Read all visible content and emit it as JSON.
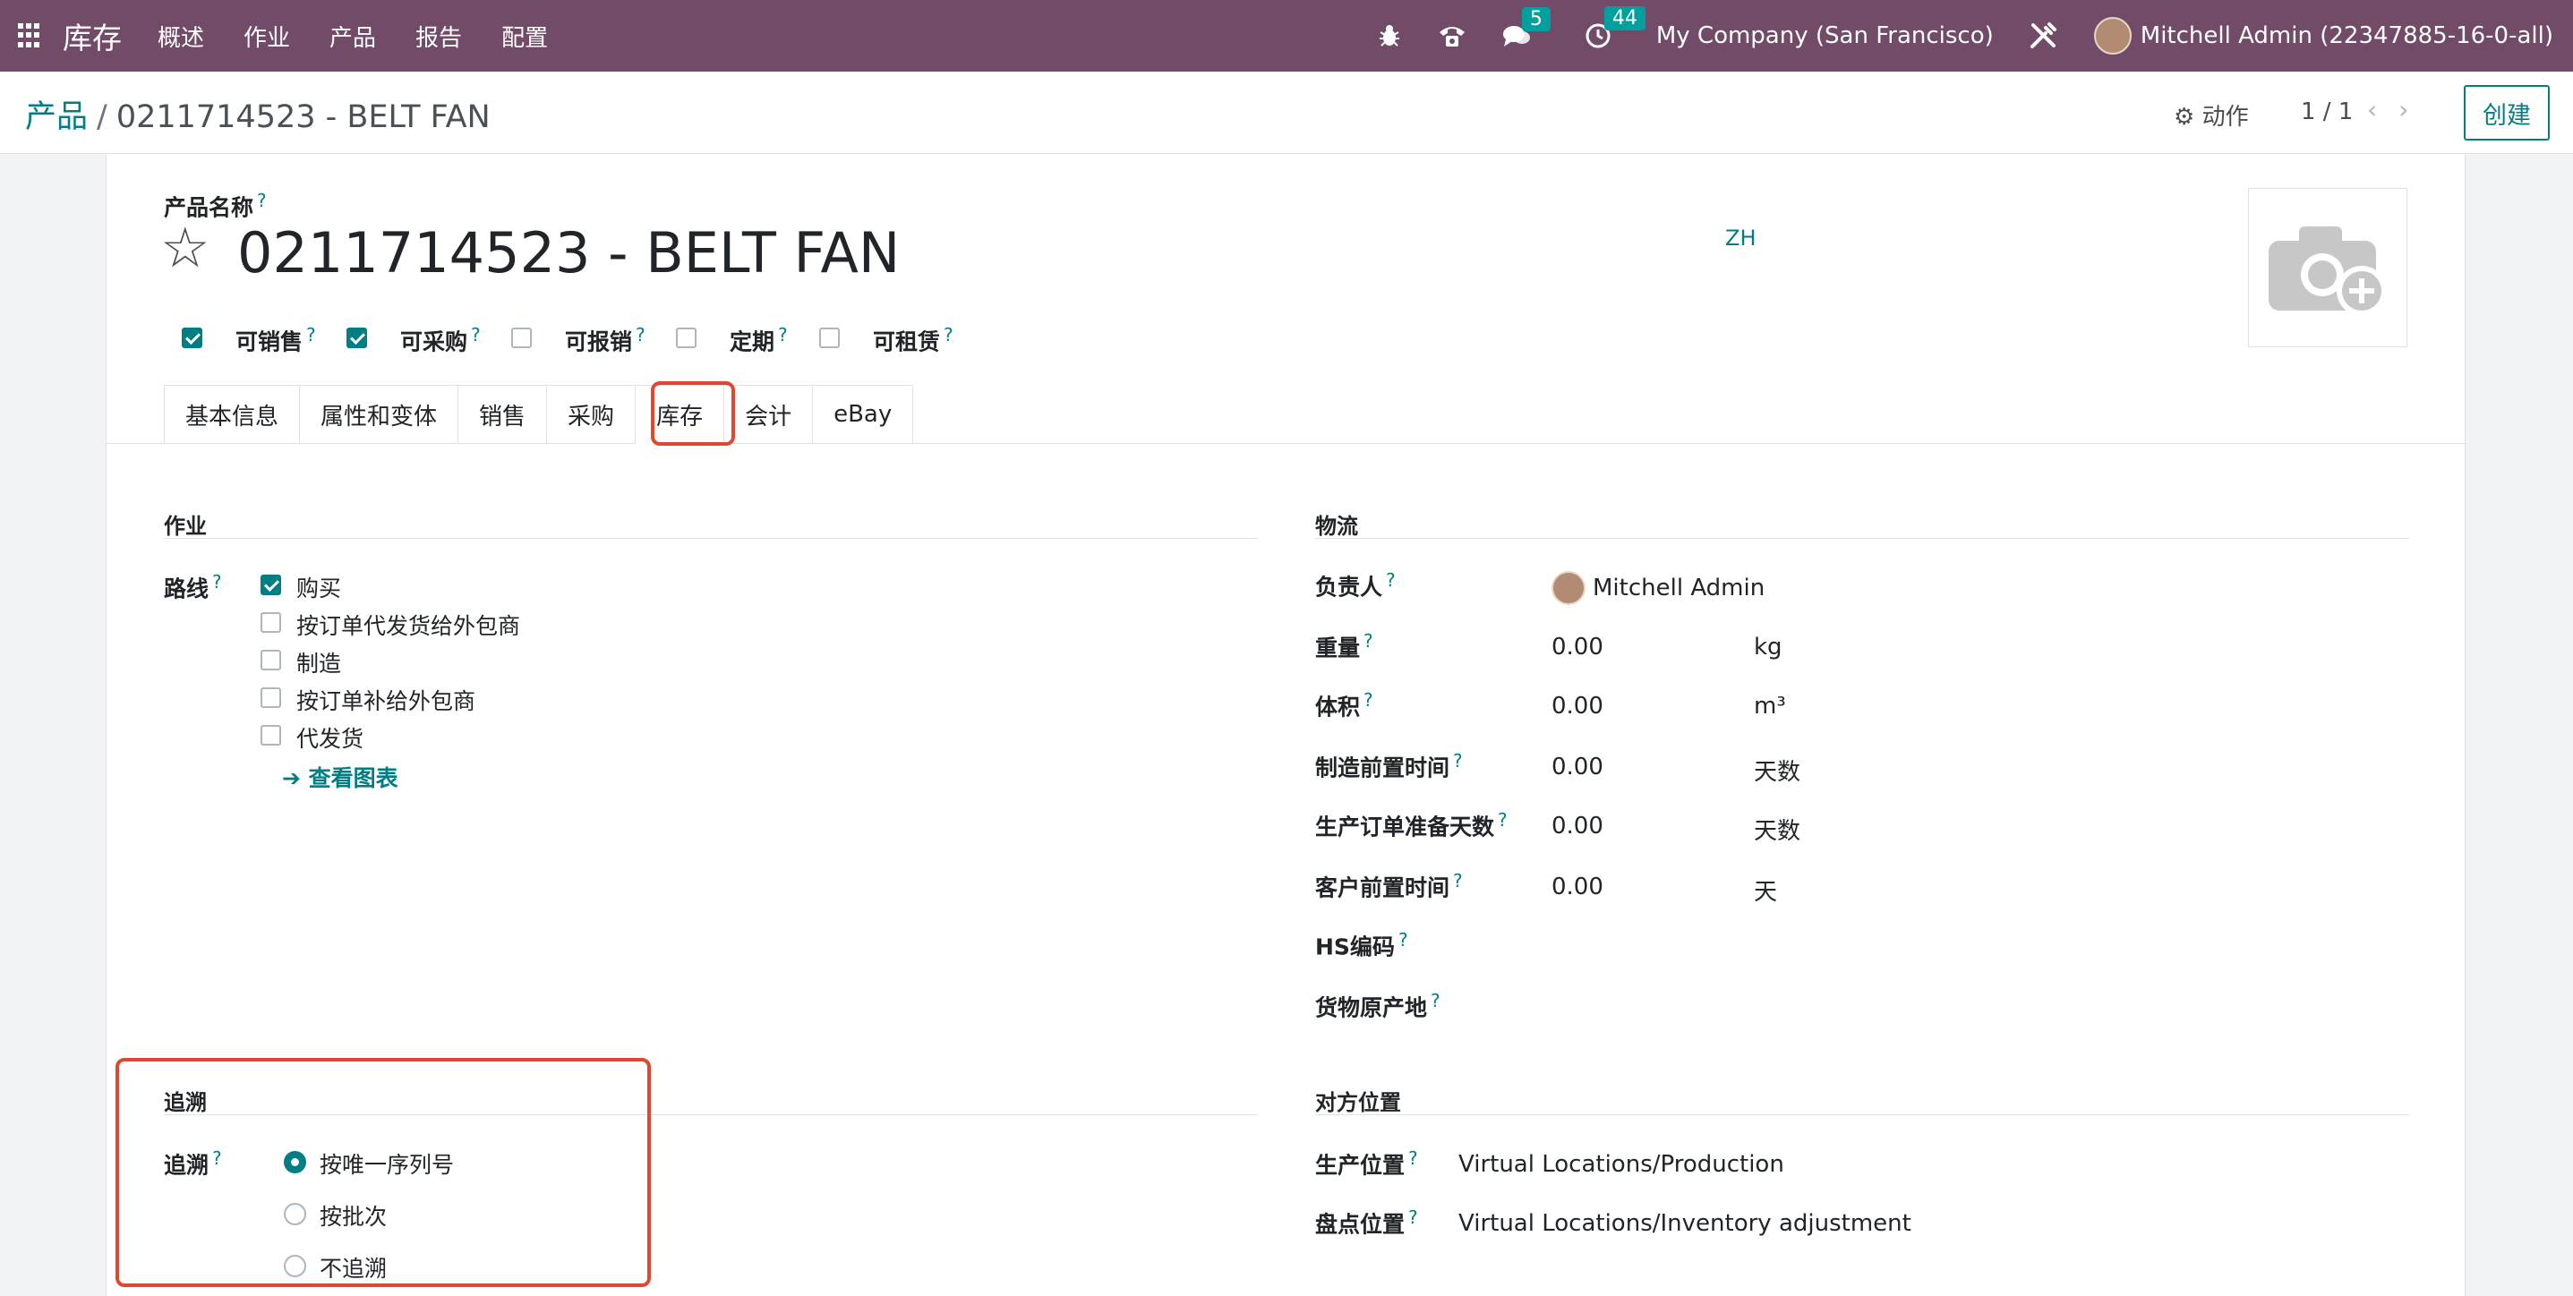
{
  "navbar": {
    "brand": "库存",
    "menu": [
      "概述",
      "作业",
      "产品",
      "报告",
      "配置"
    ],
    "messages_count": "5",
    "activities_count": "44",
    "company": "My Company (San Francisco)",
    "user": "Mitchell Admin (22347885-16-0-all)"
  },
  "control": {
    "breadcrumb_parent": "产品",
    "breadcrumb_current": "0211714523 - BELT FAN",
    "actions_label": "动作",
    "pager": "1 / 1",
    "create_label": "创建"
  },
  "product": {
    "name_label": "产品名称",
    "name": "0211714523 - BELT FAN",
    "lang": "ZH",
    "options": [
      {
        "label": "可销售",
        "checked": true
      },
      {
        "label": "可采购",
        "checked": true
      },
      {
        "label": "可报销",
        "checked": false
      },
      {
        "label": "定期",
        "checked": false
      },
      {
        "label": "可租赁",
        "checked": false
      }
    ]
  },
  "tabs": [
    "基本信息",
    "属性和变体",
    "销售",
    "采购",
    "库存",
    "会计",
    "eBay"
  ],
  "active_tab": "库存",
  "operations": {
    "title": "作业",
    "routes_label": "路线",
    "routes": [
      {
        "label": "购买",
        "checked": true
      },
      {
        "label": "按订单代发货给外包商",
        "checked": false
      },
      {
        "label": "制造",
        "checked": false
      },
      {
        "label": "按订单补给外包商",
        "checked": false
      },
      {
        "label": "代发货",
        "checked": false
      }
    ],
    "diagram_link": "查看图表"
  },
  "logistics": {
    "title": "物流",
    "responsible_label": "负责人",
    "responsible": "Mitchell Admin",
    "weight_label": "重量",
    "weight": "0.00",
    "weight_unit": "kg",
    "volume_label": "体积",
    "volume": "0.00",
    "volume_unit": "m³",
    "mfg_lead_label": "制造前置时间",
    "mfg_lead": "0.00",
    "mfg_lead_unit": "天数",
    "prep_days_label": "生产订单准备天数",
    "prep_days": "0.00",
    "prep_days_unit": "天数",
    "customer_lead_label": "客户前置时间",
    "customer_lead": "0.00",
    "customer_lead_unit": "天",
    "hs_code_label": "HS编码",
    "origin_label": "货物原产地"
  },
  "traceability": {
    "title": "追溯",
    "field_label": "追溯",
    "options": [
      {
        "label": "按唯一序列号",
        "checked": true
      },
      {
        "label": "按批次",
        "checked": false
      },
      {
        "label": "不追溯",
        "checked": false
      }
    ]
  },
  "counterpart": {
    "title": "对方位置",
    "production_label": "生产位置",
    "production": "Virtual Locations/Production",
    "inventory_label": "盘点位置",
    "inventory": "Virtual Locations/Inventory adjustment"
  },
  "colors": {
    "navbar": "#714b67",
    "accent": "#017e84",
    "highlight": "#e0472e"
  }
}
